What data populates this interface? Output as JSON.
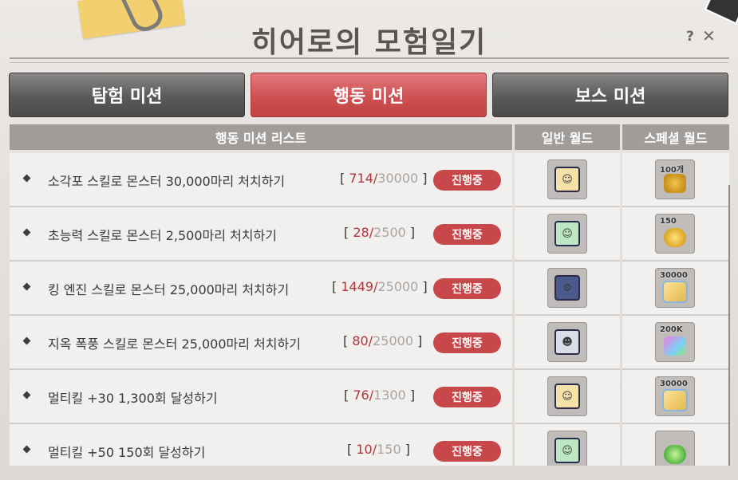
{
  "window": {
    "title": "히어로의 모험일기",
    "help_label": "?",
    "close_label": "✕"
  },
  "tabs": [
    {
      "label": "탐험 미션",
      "active": false
    },
    {
      "label": "행동 미션",
      "active": true
    },
    {
      "label": "보스 미션",
      "active": false
    }
  ],
  "columns": {
    "mission_list": "행동 미션 리스트",
    "normal_world": "일반 월드",
    "special_world": "스페셜 월드"
  },
  "missions": [
    {
      "name": "소각포 스킬로 몬스터 30,000마리 처치하기",
      "bracket_open": "[",
      "current": "714",
      "sep": "/",
      "total": "30000",
      "bracket_close": "]",
      "status": "진행중",
      "normal_icon": "hero-avatar-blonde-icon",
      "special_icon": "medal-icon",
      "special_tag": "100개"
    },
    {
      "name": "초능력 스킬로 몬스터 2,500마리 처치하기",
      "bracket_open": "[",
      "current": "28",
      "sep": "/",
      "total": "2500",
      "bracket_close": "]",
      "status": "진행중",
      "normal_icon": "hero-avatar-green-icon",
      "special_icon": "meso-bag-icon",
      "special_tag": "150"
    },
    {
      "name": "킹 엔진 스킬로 몬스터 25,000마리 처치하기",
      "bracket_open": "[",
      "current": "1449",
      "sep": "/",
      "total": "25000",
      "bracket_close": "]",
      "status": "진행중",
      "normal_icon": "king-engine-icon",
      "special_icon": "coupon-icon",
      "special_tag": "30000"
    },
    {
      "name": "지옥 폭풍 스킬로 몬스터 25,000마리 처치하기",
      "bracket_open": "[",
      "current": "80",
      "sep": "/",
      "total": "25000",
      "bracket_close": "]",
      "status": "진행중",
      "normal_icon": "hero-avatar-dark-icon",
      "special_icon": "potion-icon",
      "special_tag": "200K"
    },
    {
      "name": "멀티킬 +30 1,300회 달성하기",
      "bracket_open": "[",
      "current": "76",
      "sep": "/",
      "total": "1300",
      "bracket_close": "]",
      "status": "진행중",
      "normal_icon": "hero-avatar-blonde-icon",
      "special_icon": "coupon-icon",
      "special_tag": "30000"
    },
    {
      "name": "멀티킬 +50 150회 달성하기",
      "bracket_open": "[",
      "current": "10",
      "sep": "/",
      "total": "150",
      "bracket_close": "]",
      "status": "진행중",
      "normal_icon": "hero-avatar-green-icon",
      "special_icon": "green-orb-icon",
      "special_tag": ""
    }
  ],
  "colors": {
    "accent": "#c8474b",
    "progress_current": "#b3343a",
    "progress_total": "#a7a3a1"
  }
}
